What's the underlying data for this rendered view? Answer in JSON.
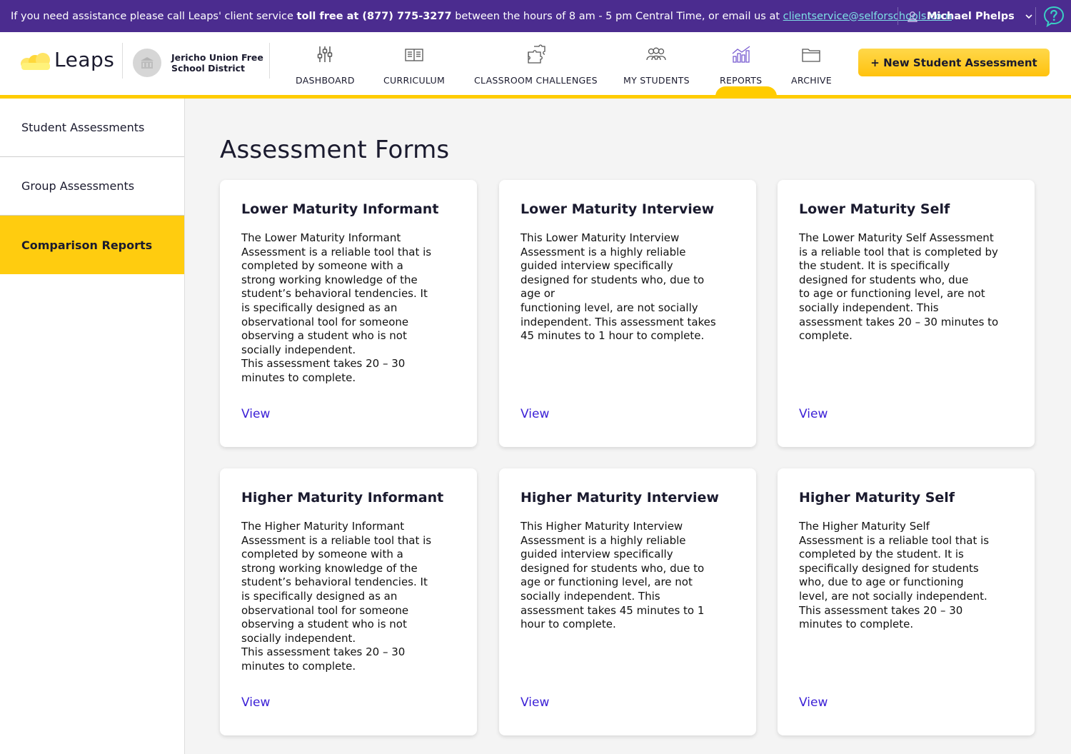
{
  "topbar": {
    "msg_prefix": "If you need assistance please call Leaps' client service ",
    "msg_bold": "toll free at (877) 775-3277",
    "msg_middle": " between the hours of 8 am - 5 pm Central Time, or email us at ",
    "email": "clientservice@selforschools.com",
    "user_name": "Michael Phelps"
  },
  "header": {
    "logo_text": "Leaps",
    "district_name": "Jericho Union Free School District",
    "nav": [
      {
        "label": "DASHBOARD",
        "icon": "sliders-icon"
      },
      {
        "label": "CURRICULUM",
        "icon": "book-icon"
      },
      {
        "label": "CLASSROOM CHALLENGES",
        "icon": "puzzle-icon"
      },
      {
        "label": "MY STUDENTS",
        "icon": "people-icon"
      },
      {
        "label": "REPORTS",
        "icon": "chart-icon"
      },
      {
        "label": "ARCHIVE",
        "icon": "folder-icon"
      }
    ],
    "active_nav": "REPORTS",
    "new_button": "+ New Student Assessment"
  },
  "sidebar": {
    "items": [
      {
        "label": "Student Assessments",
        "active": false
      },
      {
        "label": "Group Assessments",
        "active": false
      },
      {
        "label": "Comparison Reports",
        "active": true
      }
    ]
  },
  "main": {
    "title": "Assessment Forms",
    "cards": [
      {
        "title": "Lower Maturity Informant",
        "body": "The Lower Maturity Informant\nAssessment is a reliable tool that is\ncompleted by someone with a\nstrong working knowledge of the\nstudent’s behavioral tendencies.  It\nis specifically designed as an\nobservational tool for someone\nobserving a student who is not\nsocially independent.\nThis assessment takes 20 – 30\nminutes to complete.",
        "link": "View"
      },
      {
        "title": "Lower Maturity Interview",
        "body": "This Lower Maturity Interview\nAssessment is a highly reliable\nguided interview specifically\ndesigned for students who, due to\nage or\n functioning level, are not socially\nindependent.  This assessment takes\n45 minutes to 1 hour to complete.",
        "link": "View"
      },
      {
        "title": "Lower Maturity Self",
        "body": "The Lower Maturity Self Assessment\nis a reliable tool that is completed by\nthe student.  It is specifically\ndesigned for students who, due\n to age or functioning level, are not\nsocially independent.   This\nassessment takes 20 – 30 minutes to\ncomplete.",
        "link": "View"
      },
      {
        "title": "Higher Maturity Informant",
        "body": "The Higher Maturity Informant\nAssessment is a reliable tool that is\ncompleted by someone with a\nstrong working knowledge of the\nstudent’s behavioral tendencies.  It\nis specifically designed as an\nobservational tool for someone\nobserving a student who is not\nsocially independent.\nThis assessment takes 20 – 30\nminutes to complete.",
        "link": "View"
      },
      {
        "title": "Higher Maturity Interview",
        "body": "This Higher Maturity Interview\nAssessment is a highly reliable\nguided interview specifically\ndesigned for students who, due to\nage or functioning level, are not\nsocially independent.  This\nassessment takes 45 minutes to 1\nhour to complete.",
        "link": "View"
      },
      {
        "title": "Higher Maturity Self",
        "body": "The Higher Maturity Self\nAssessment is a reliable tool that is\ncompleted by the student.  It is\nspecifically designed for students\nwho, due to age or functioning\nlevel, are not socially independent.\nThis assessment takes 20 – 30\nminutes to complete.",
        "link": "View"
      }
    ]
  },
  "colors": {
    "topbar": "#4b2c8f",
    "accent_yellow": "#ffcc00",
    "link_blue": "#3a1fd6",
    "email_cyan": "#7ee0e6"
  }
}
